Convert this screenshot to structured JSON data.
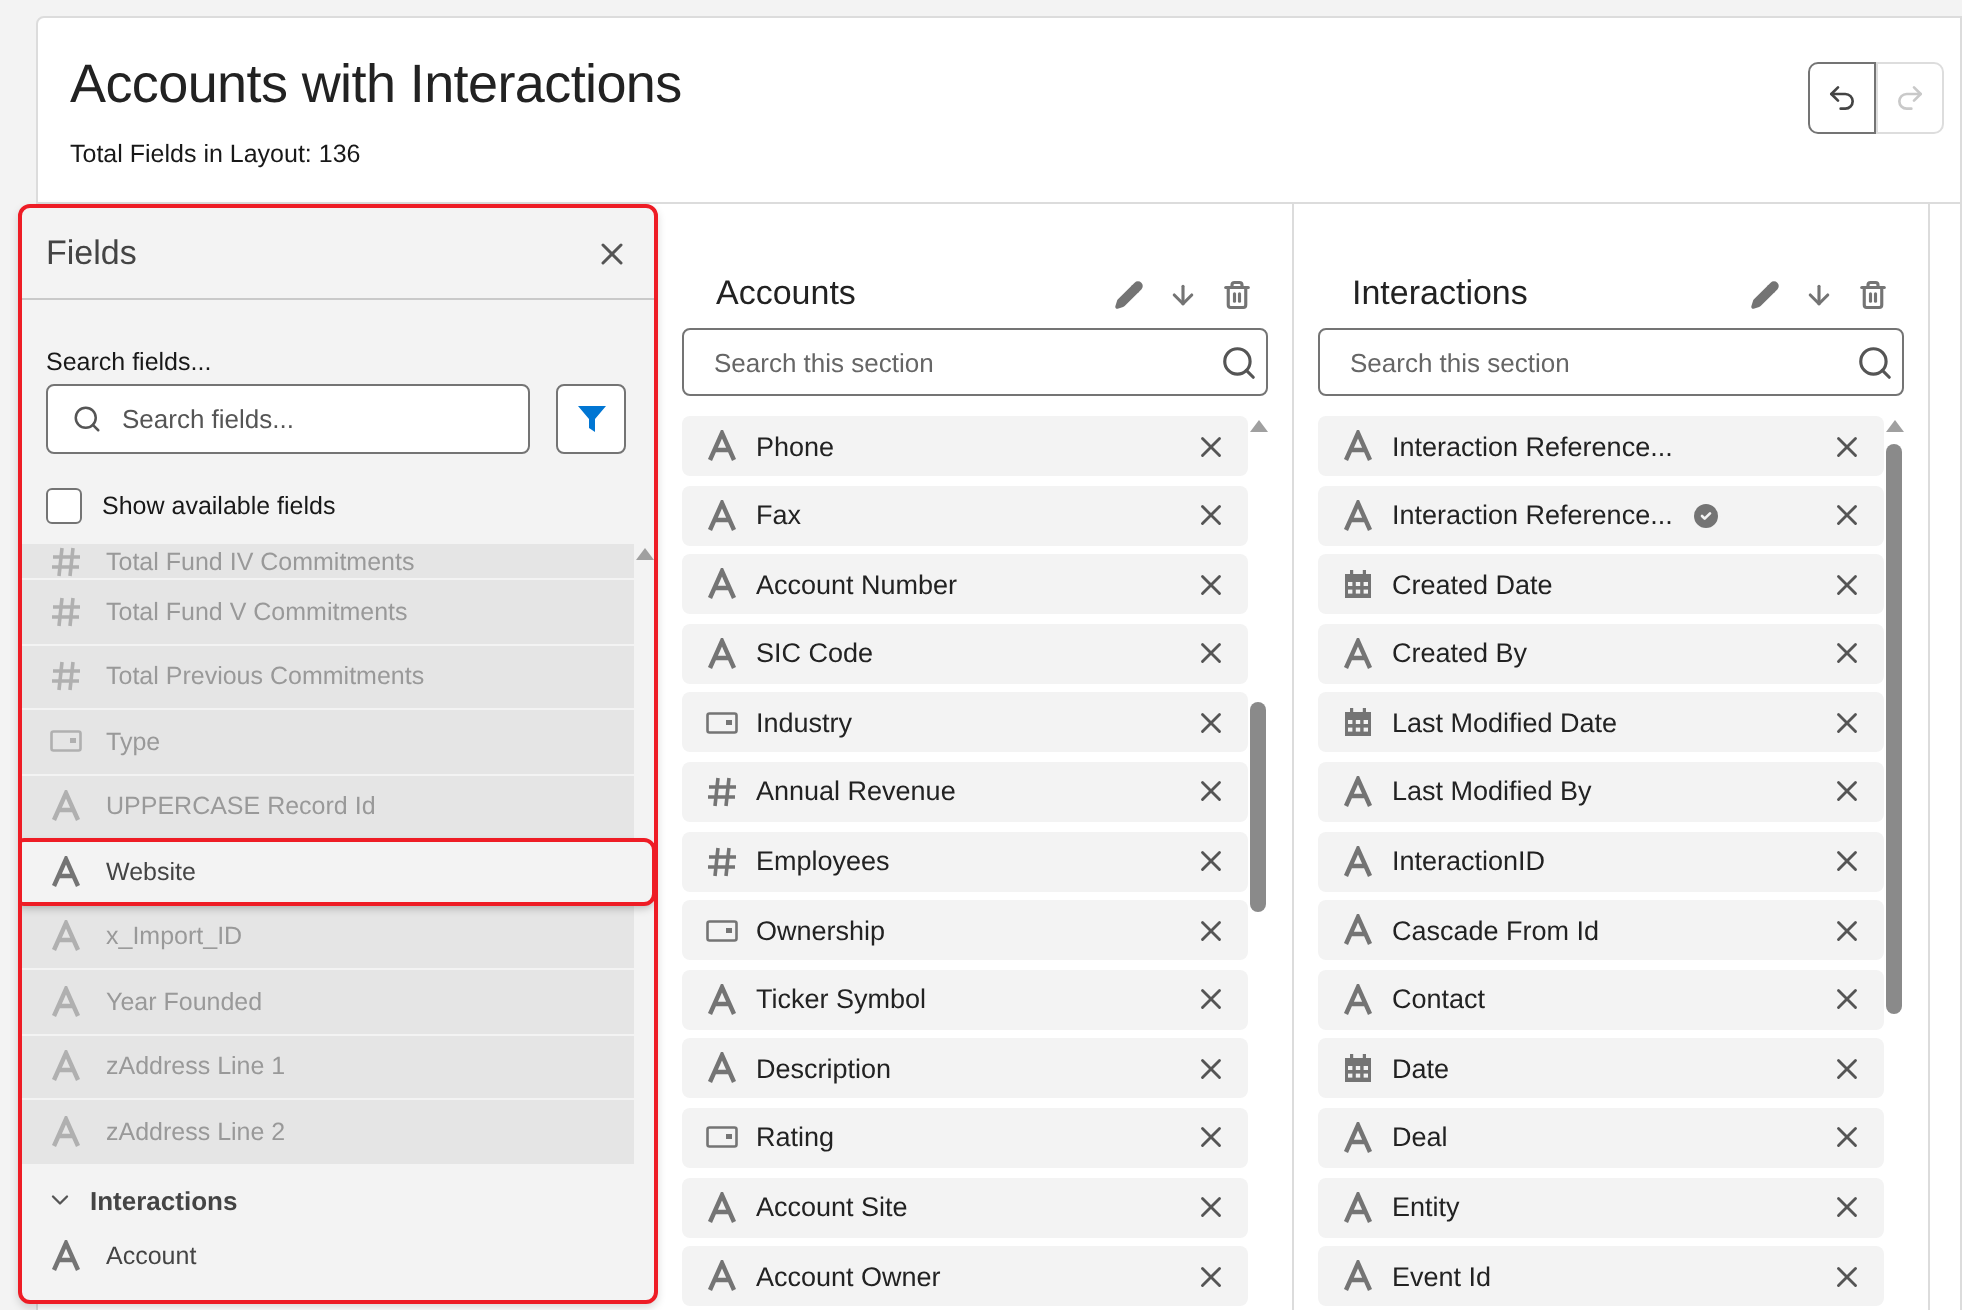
{
  "header": {
    "title": "Accounts with Interactions",
    "subtitle": "Total Fields in Layout: 136",
    "undo": {
      "disabled": false
    },
    "redo": {
      "disabled": true
    }
  },
  "fields_panel": {
    "title": "Fields",
    "highlighted": true,
    "search_label": "Search fields...",
    "search": {
      "placeholder": "Search fields..."
    },
    "show_available": {
      "label": "Show available fields",
      "checked": false
    },
    "items": [
      {
        "kind": "number",
        "label": "Total Fund IV Commitments",
        "dimmed": true,
        "highlighted": false
      },
      {
        "kind": "number",
        "label": "Total Fund V Commitments",
        "dimmed": true,
        "highlighted": false
      },
      {
        "kind": "number",
        "label": "Total Previous Commitments",
        "dimmed": true,
        "highlighted": false
      },
      {
        "kind": "picklist",
        "label": "Type",
        "dimmed": true,
        "highlighted": false
      },
      {
        "kind": "text",
        "label": "UPPERCASE Record Id",
        "dimmed": true,
        "highlighted": false
      },
      {
        "kind": "text",
        "label": "Website",
        "dimmed": false,
        "highlighted": true
      },
      {
        "kind": "text",
        "label": "x_Import_ID",
        "dimmed": true,
        "highlighted": false
      },
      {
        "kind": "text",
        "label": "Year Founded",
        "dimmed": true,
        "highlighted": false
      },
      {
        "kind": "text",
        "label": "zAddress Line 1",
        "dimmed": true,
        "highlighted": false
      },
      {
        "kind": "text",
        "label": "zAddress Line 2",
        "dimmed": true,
        "highlighted": false
      }
    ],
    "group": {
      "title": "Interactions",
      "expanded": true,
      "items": [
        {
          "kind": "text",
          "label": "Account",
          "dimmed": false,
          "highlighted": false
        }
      ]
    }
  },
  "sections": [
    {
      "title": "Accounts",
      "search": {
        "placeholder": "Search this section"
      },
      "fields": [
        {
          "kind": "text",
          "label": "Phone",
          "verified": false
        },
        {
          "kind": "text",
          "label": "Fax",
          "verified": false
        },
        {
          "kind": "text",
          "label": "Account Number",
          "verified": false
        },
        {
          "kind": "text",
          "label": "SIC Code",
          "verified": false
        },
        {
          "kind": "picklist",
          "label": "Industry",
          "verified": false
        },
        {
          "kind": "number",
          "label": "Annual Revenue",
          "verified": false
        },
        {
          "kind": "number",
          "label": "Employees",
          "verified": false
        },
        {
          "kind": "picklist",
          "label": "Ownership",
          "verified": false
        },
        {
          "kind": "text",
          "label": "Ticker Symbol",
          "verified": false
        },
        {
          "kind": "text",
          "label": "Description",
          "verified": false
        },
        {
          "kind": "picklist",
          "label": "Rating",
          "verified": false
        },
        {
          "kind": "text",
          "label": "Account Site",
          "verified": false
        },
        {
          "kind": "text",
          "label": "Account Owner",
          "verified": false
        }
      ]
    },
    {
      "title": "Interactions",
      "search": {
        "placeholder": "Search this section"
      },
      "fields": [
        {
          "kind": "text",
          "label": "Interaction Reference...",
          "verified": false
        },
        {
          "kind": "text",
          "label": "Interaction Reference...",
          "verified": true
        },
        {
          "kind": "date",
          "label": "Created Date",
          "verified": false
        },
        {
          "kind": "text",
          "label": "Created By",
          "verified": false
        },
        {
          "kind": "date",
          "label": "Last Modified Date",
          "verified": false
        },
        {
          "kind": "text",
          "label": "Last Modified By",
          "verified": false
        },
        {
          "kind": "text",
          "label": "InteractionID",
          "verified": false
        },
        {
          "kind": "text",
          "label": "Cascade From Id",
          "verified": false
        },
        {
          "kind": "text",
          "label": "Contact",
          "verified": false
        },
        {
          "kind": "date",
          "label": "Date",
          "verified": false
        },
        {
          "kind": "text",
          "label": "Deal",
          "verified": false
        },
        {
          "kind": "text",
          "label": "Entity",
          "verified": false
        },
        {
          "kind": "text",
          "label": "Event Id",
          "verified": false
        }
      ]
    }
  ]
}
